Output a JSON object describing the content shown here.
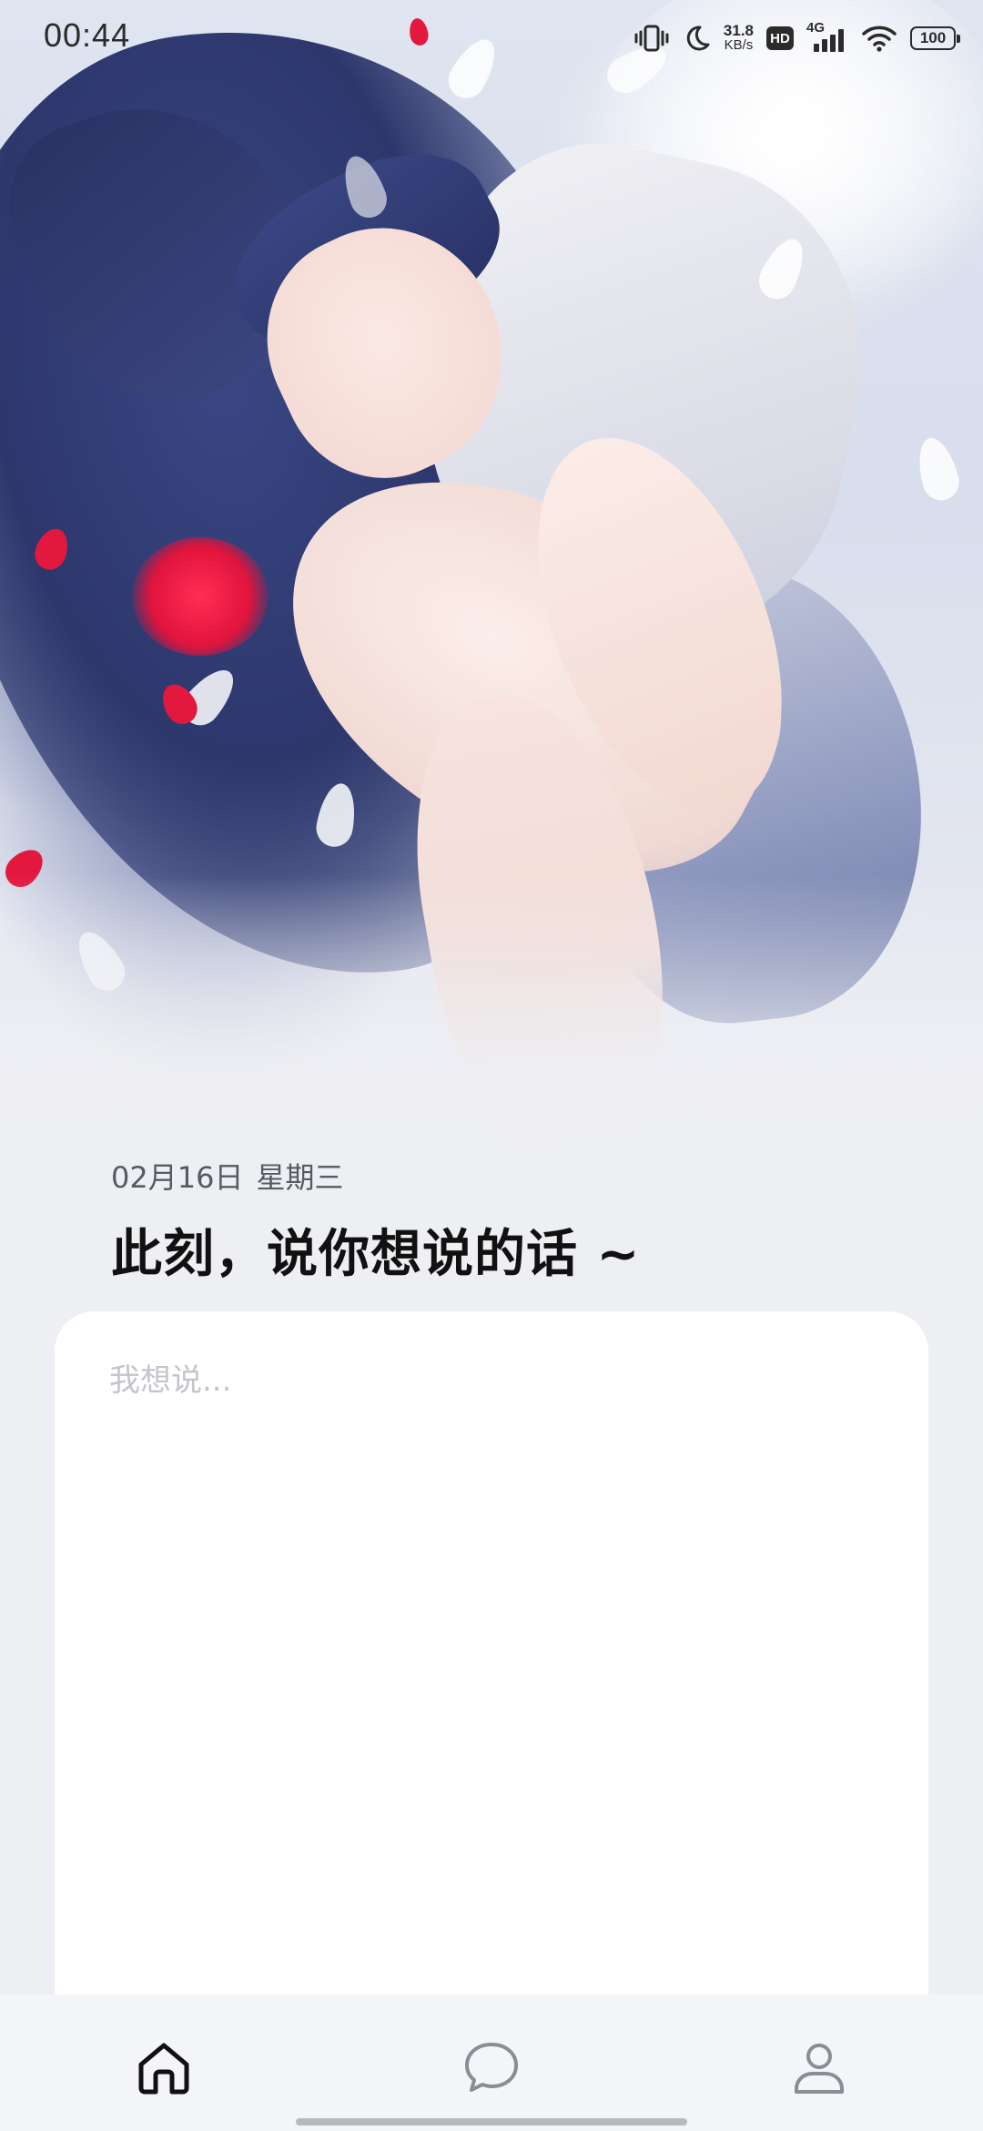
{
  "status_bar": {
    "time": "00:44",
    "net_speed_value": "31.8",
    "net_speed_unit": "KB/s",
    "hd_label": "HD",
    "signal_label": "4G",
    "battery": "100",
    "icons": [
      "vibrate-icon",
      "moon-icon",
      "hd-icon",
      "signal-4g-icon",
      "wifi-icon",
      "battery-icon"
    ]
  },
  "header": {
    "date": "02月16日",
    "weekday": "星期三",
    "headline": "此刻，说你想说的话 ~"
  },
  "composer": {
    "placeholder": "我想说...",
    "value": ""
  },
  "bottom_nav": {
    "items": [
      {
        "icon": "home-icon",
        "active": true
      },
      {
        "icon": "chat-icon",
        "active": false
      },
      {
        "icon": "profile-icon",
        "active": false
      }
    ],
    "active_color": "#111111",
    "inactive_color": "#8a8d94"
  }
}
